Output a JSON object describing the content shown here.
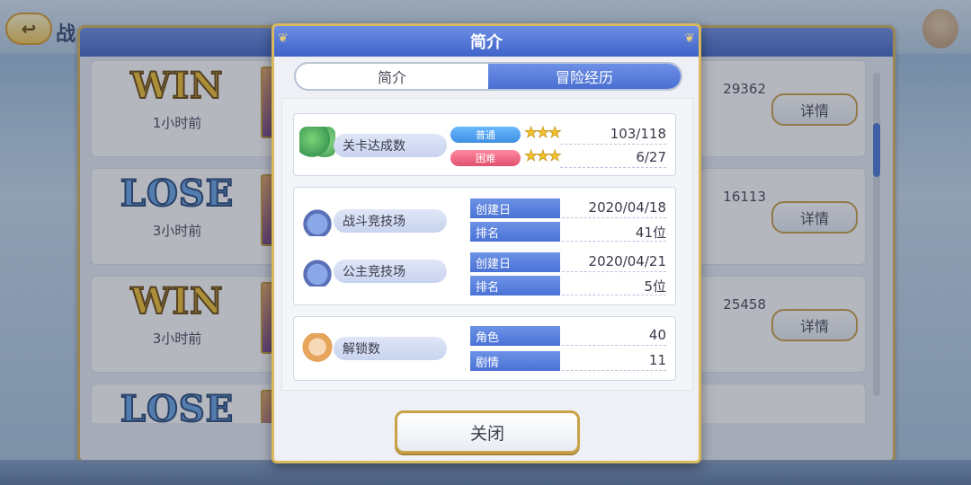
{
  "background": {
    "title": "战",
    "rows": [
      {
        "result": "WIN",
        "time": "1小时前",
        "score": "29362",
        "detail": "详情",
        "type": "win"
      },
      {
        "result": "LOSE",
        "time": "3小时前",
        "score": "16113",
        "detail": "详情",
        "type": "lose"
      },
      {
        "result": "WIN",
        "time": "3小时前",
        "score": "25458",
        "detail": "详情",
        "type": "win"
      },
      {
        "result": "LOSE",
        "time": "",
        "score": "",
        "detail": "",
        "type": "lose"
      }
    ]
  },
  "modal": {
    "title": "简介",
    "tabs": [
      {
        "label": "简介",
        "active": false
      },
      {
        "label": "冒险经历",
        "active": true
      }
    ],
    "quest": {
      "name": "关卡达成数",
      "icon": "tree-icon",
      "rows": [
        {
          "badge": "普通",
          "stars": "★★★",
          "value": "103/118"
        },
        {
          "badge": "困难",
          "stars": "★★★",
          "value": "6/27"
        }
      ]
    },
    "battle_arena": {
      "name": "战斗竞技场",
      "icon": "arena-icon",
      "created_label": "创建日",
      "created_value": "2020/04/18",
      "rank_label": "排名",
      "rank_value": "41位"
    },
    "princess_arena": {
      "name": "公主竞技场",
      "icon": "arena-icon",
      "created_label": "创建日",
      "created_value": "2020/04/21",
      "rank_label": "排名",
      "rank_value": "5位"
    },
    "unlocks": {
      "name": "解锁数",
      "icon": "character-icon",
      "char_label": "角色",
      "char_value": "40",
      "story_label": "剧情",
      "story_value": "11"
    },
    "close_label": "关闭"
  },
  "colors": {
    "header_blue": "#4a6fd2",
    "gold_border": "#d9b85e",
    "normal_badge": "#3f8fe3",
    "hard_badge": "#e0506f",
    "star": "#f3c02a"
  }
}
